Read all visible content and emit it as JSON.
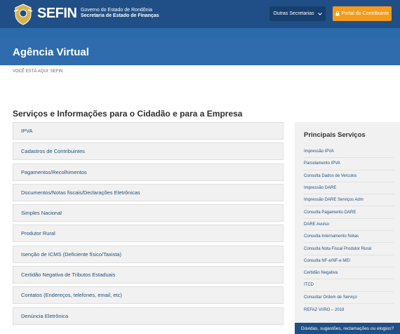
{
  "header": {
    "brand": "SEFIN",
    "gov_line1": "Governo do Estado de Rondônia",
    "gov_line2": "Secretaria de Estado de Finanças",
    "outras_label": "Outras Secretarias",
    "portal_label": "Portal do Contribuinte",
    "colors": {
      "topbar": "#1f4f86",
      "accent": "#f29b1d"
    }
  },
  "hero": {
    "title": "Agência Virtual"
  },
  "breadcrumb": "VOCÊ ESTÁ AQUI: SEFIN",
  "main": {
    "section_title": "Serviços e Informações para o Cidadão e para a Empresa",
    "items": [
      "IPVA",
      "Cadastros de Contribuintes",
      "Pagamentos/Recolhimentos",
      "Documentos/Notas fiscais/Declarações Eletrônicas",
      "Simples Nacional",
      "Produtor Rural",
      "Isenção de ICMS (Deficiente físico/Taxista)",
      "Certidão Negativa de Tributos Estaduais",
      "Contatos (Endereços, telefones, email, etc)",
      "Denúncia Eletrônica"
    ]
  },
  "sidebar": {
    "title": "Principais Serviços",
    "links": [
      "Impressão IPVA",
      "Parcelamento IPVA",
      "Consulta Dados de Veículos",
      "Impressão DARE",
      "Impressão DARE Serviços Adm",
      "Consulta Pagamento DARE",
      "DARE Avulso",
      "Consulta Internamento Notas",
      "Consulta Nota Fiscal Produtor Rural",
      "Consulta NF-e/NF-e MEI",
      "Certidão Negativa",
      "ITCD",
      "Consultar Ordem de Serviço",
      "REFAZ VI/RO – 2018"
    ]
  },
  "feedback": "Dúvidas, sugestões, reclamações ou elogios?"
}
